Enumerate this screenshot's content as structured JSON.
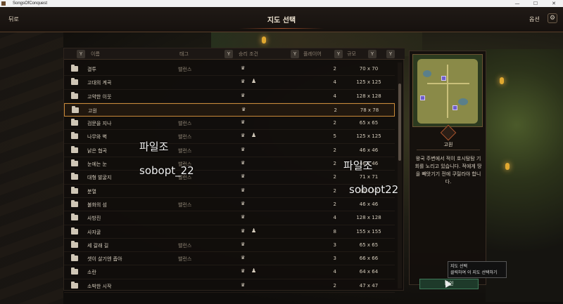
{
  "window": {
    "app_title": "SongsOfConquest",
    "controls": [
      "—",
      "☐",
      "✕"
    ]
  },
  "header": {
    "back_label": "뒤로",
    "title": "지도 선택",
    "options_label": "옵션",
    "gear_icon": "gear-icon"
  },
  "columns": {
    "name": "이름",
    "tag": "태그",
    "victory": "승리 조건",
    "players": "플레이어",
    "size": "규모"
  },
  "maps": [
    {
      "name": "결투",
      "tag": "밸런스",
      "potion": false,
      "players": "2",
      "size": "70 x 70"
    },
    {
      "name": "고대의 계곡",
      "tag": "",
      "potion": true,
      "players": "4",
      "size": "125 x 125"
    },
    {
      "name": "고약한 이웃",
      "tag": "",
      "potion": false,
      "players": "4",
      "size": "128 x 128"
    },
    {
      "name": "고원",
      "tag": "",
      "potion": false,
      "players": "2",
      "size": "78 x 78",
      "selected": true
    },
    {
      "name": "검문을 지나",
      "tag": "밸런스",
      "potion": false,
      "players": "2",
      "size": "65 x 65"
    },
    {
      "name": "나무와 벽",
      "tag": "밸런스",
      "potion": true,
      "players": "5",
      "size": "125 x 125"
    },
    {
      "name": "낡은 협곡",
      "tag": "밸런스",
      "potion": false,
      "players": "2",
      "size": "46 x 46"
    },
    {
      "name": "눈에는 눈",
      "tag": "밸런스",
      "potion": false,
      "players": "2",
      "size": "46 x 46"
    },
    {
      "name": "대형 발굴지",
      "tag": "밸런스",
      "potion": false,
      "players": "2",
      "size": "71 x 71"
    },
    {
      "name": "분열",
      "tag": "",
      "potion": false,
      "players": "2",
      "size": "80 x 80"
    },
    {
      "name": "불화의 섬",
      "tag": "밸런스",
      "potion": false,
      "players": "2",
      "size": "46 x 46"
    },
    {
      "name": "사방진",
      "tag": "",
      "potion": false,
      "players": "4",
      "size": "128 x 128"
    },
    {
      "name": "사자굴",
      "tag": "",
      "potion": true,
      "players": "8",
      "size": "155 x 155"
    },
    {
      "name": "세 갈래 길",
      "tag": "밸런스",
      "potion": false,
      "players": "3",
      "size": "65 x 65"
    },
    {
      "name": "셋이 살기엔 좁아",
      "tag": "밸런스",
      "potion": false,
      "players": "3",
      "size": "66 x 66"
    },
    {
      "name": "소란",
      "tag": "",
      "potion": true,
      "players": "4",
      "size": "64 x 64"
    },
    {
      "name": "소박한 시작",
      "tag": "",
      "potion": false,
      "players": "2",
      "size": "47 x 47"
    }
  ],
  "detail": {
    "map_title": "고원",
    "description": "왕국 주변에서 적이 호시탐탐 기회를 노리고 있습니다. 적에게 땅을 빼앗기기 전에 쿠릴라야 합니다."
  },
  "confirm_label": "확인",
  "tooltip": {
    "title": "지도 선택",
    "body": "클릭하여 이 지도 선택하기"
  },
  "watermarks": {
    "left_name": "파일조",
    "left_id": "sobopt_22",
    "right_name": "파일조",
    "right_id": "sobopt22"
  }
}
